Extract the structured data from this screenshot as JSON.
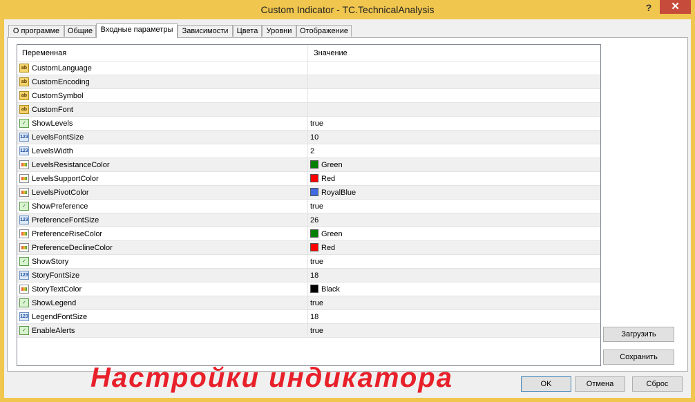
{
  "window": {
    "title": "Custom Indicator - TC.TechnicalAnalysis",
    "help_glyph": "?",
    "close_glyph": "✕"
  },
  "tabs": [
    {
      "label": "О программе"
    },
    {
      "label": "Общие"
    },
    {
      "label": "Входные параметры",
      "active": true
    },
    {
      "label": "Зависимости"
    },
    {
      "label": "Цвета"
    },
    {
      "label": "Уровни"
    },
    {
      "label": "Отображение"
    }
  ],
  "grid": {
    "columns": [
      "Переменная",
      "Значение"
    ],
    "rows": [
      {
        "name": "CustomLanguage",
        "type": "string",
        "value": ""
      },
      {
        "name": "CustomEncoding",
        "type": "string",
        "value": ""
      },
      {
        "name": "CustomSymbol",
        "type": "string",
        "value": ""
      },
      {
        "name": "CustomFont",
        "type": "string",
        "value": ""
      },
      {
        "name": "ShowLevels",
        "type": "bool",
        "value": "true"
      },
      {
        "name": "LevelsFontSize",
        "type": "int",
        "value": "10"
      },
      {
        "name": "LevelsWidth",
        "type": "int",
        "value": "2"
      },
      {
        "name": "LevelsResistanceColor",
        "type": "color",
        "value": "Green",
        "swatch": "#008000"
      },
      {
        "name": "LevelsSupportColor",
        "type": "color",
        "value": "Red",
        "swatch": "#ff0000"
      },
      {
        "name": "LevelsPivotColor",
        "type": "color",
        "value": "RoyalBlue",
        "swatch": "#4169e1"
      },
      {
        "name": "ShowPreference",
        "type": "bool",
        "value": "true"
      },
      {
        "name": "PreferenceFontSize",
        "type": "int",
        "value": "26"
      },
      {
        "name": "PreferenceRiseColor",
        "type": "color",
        "value": "Green",
        "swatch": "#008000"
      },
      {
        "name": "PreferenceDeclineColor",
        "type": "color",
        "value": "Red",
        "swatch": "#ff0000"
      },
      {
        "name": "ShowStory",
        "type": "bool",
        "value": "true"
      },
      {
        "name": "StoryFontSize",
        "type": "int",
        "value": "18"
      },
      {
        "name": "StoryTextColor",
        "type": "color",
        "value": "Black",
        "swatch": "#000000"
      },
      {
        "name": "ShowLegend",
        "type": "bool",
        "value": "true"
      },
      {
        "name": "LegendFontSize",
        "type": "int",
        "value": "18"
      },
      {
        "name": "EnableAlerts",
        "type": "bool",
        "value": "true"
      }
    ]
  },
  "icons": {
    "string": "ab",
    "bool": "✓",
    "int": "123",
    "color": ""
  },
  "overlay_text": "Настройки индикатора",
  "side_buttons": {
    "load": "Загрузить",
    "save": "Сохранить"
  },
  "footer_buttons": {
    "ok": "OK",
    "cancel": "Отмена",
    "reset": "Сброс"
  }
}
